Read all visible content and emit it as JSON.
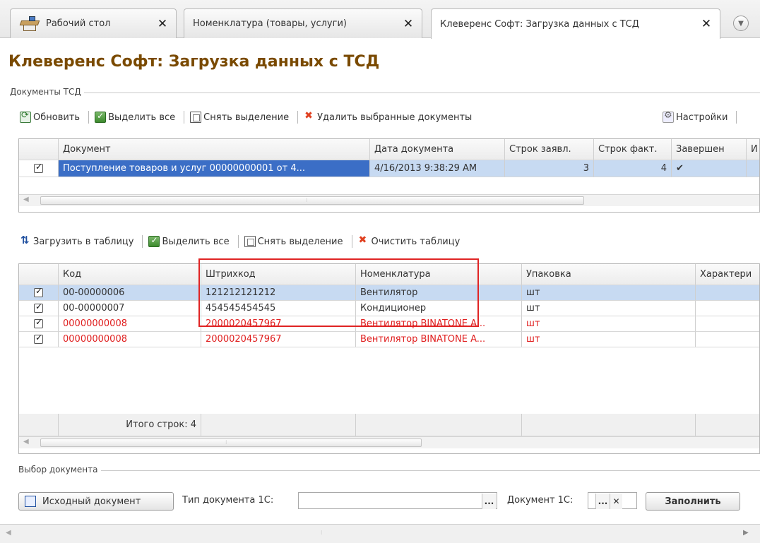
{
  "tabs": [
    {
      "label": "Рабочий стол"
    },
    {
      "label": "Номенклатура (товары, услуги)"
    },
    {
      "label": "Клеверенс Софт: Загрузка данных с ТСД"
    }
  ],
  "form_title": "Клеверенс Софт: Загрузка данных с ТСД",
  "docs_group": {
    "title": "Документы ТСД",
    "toolbar": {
      "refresh": "Обновить",
      "select_all": "Выделить все",
      "deselect": "Снять выделение",
      "delete_selected": "Удалить выбранные документы",
      "settings": "Настройки"
    },
    "columns": [
      "Документ",
      "Дата документа",
      "Строк заявл.",
      "Строк факт.",
      "Завершен",
      "И"
    ],
    "rows": [
      {
        "document": "Поступление товаров и услуг 00000000001 от 4...",
        "date": "4/16/2013 9:38:29 AM",
        "lines_declared": "3",
        "lines_actual": "4",
        "completed": "✔",
        "extra": "✔"
      }
    ]
  },
  "items_toolbar": {
    "load": "Загрузить в таблицу",
    "select_all": "Выделить все",
    "deselect": "Снять выделение",
    "clear": "Очистить таблицу"
  },
  "items": {
    "columns": [
      "Код",
      "Штрихкод",
      "Номенклатура",
      "Упаковка",
      "Характери"
    ],
    "rows": [
      {
        "code": "00-00000006",
        "barcode": "121212121212",
        "name": "Вентилятор",
        "pack": "шт"
      },
      {
        "code": "00-00000007",
        "barcode": "454545454545",
        "name": "Кондиционер",
        "pack": "шт"
      },
      {
        "code": "00000000008",
        "barcode": "2000020457967",
        "name": "Вентилятор BINATONE A...",
        "pack": "шт"
      },
      {
        "code": "00000000008",
        "barcode": "2000020457967",
        "name": "Вентилятор BINATONE A...",
        "pack": "шт"
      }
    ],
    "footer": "Итого строк: 4"
  },
  "doc_select": {
    "title": "Выбор документа",
    "source_button": "Исходный документ",
    "type_label": "Тип документа 1С:",
    "type_value": "",
    "doc_label": "Документ 1С:",
    "fill_button": "Заполнить",
    "ellipsis": "...",
    "clear": "✕"
  },
  "colors": {
    "title": "#7a4a00",
    "selection": "#c7daf2",
    "highlight": "#e02424",
    "error_text": "#e02020"
  }
}
